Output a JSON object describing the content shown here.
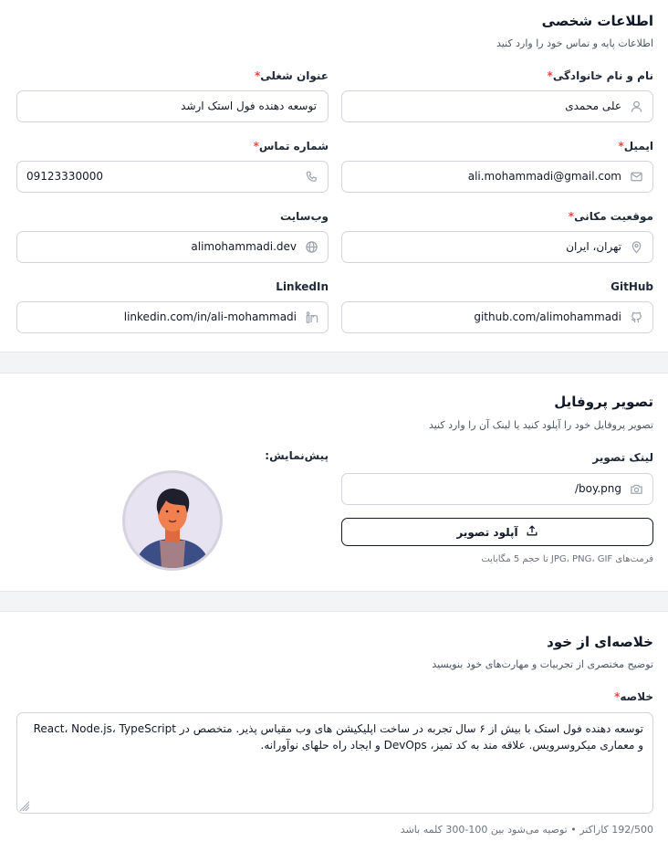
{
  "personal": {
    "title": "اطلاعات شخصی",
    "subtitle": "اطلاعات پایه و تماس خود را وارد کنید",
    "fullname_label": "نام و نام خانوادگی",
    "fullname_value": "علی محمدی",
    "jobtitle_label": "عنوان شغلی",
    "jobtitle_value": "توسعه دهنده فول استک ارشد",
    "email_label": "ایمیل",
    "email_value": "ali.mohammadi@gmail.com",
    "phone_label": "شماره تماس",
    "phone_value": "09123330000",
    "location_label": "موقعیت مکانی",
    "location_value": "تهران، ایران",
    "website_label": "وب‌سایت",
    "website_value": "alimohammadi.dev",
    "github_label": "GitHub",
    "github_value": "github.com/alimohammadi",
    "linkedin_label": "LinkedIn",
    "linkedin_value": "linkedin.com/in/ali-mohammadi",
    "required_mark": "*"
  },
  "profile": {
    "title": "تصویر پروفایل",
    "subtitle": "تصویر پروفایل خود را آپلود کنید یا لینک آن را وارد کنید",
    "image_link_label": "لینک تصویر",
    "image_link_value": "/boy.png",
    "upload_button": "آپلود تصویر",
    "formats_hint": "فرمت‌های JPG، PNG، GIF تا حجم 5 مگابایت",
    "preview_label": "پیش‌نمایش:"
  },
  "summary": {
    "title": "خلاصه‌ای از خود",
    "subtitle": "توضیح مختصری از تجربیات و مهارت‌های خود بنویسید",
    "label": "خلاصه",
    "value": "توسعه دهنده فول استک با بیش از ۶ سال تجربه در ساخت اپلیکیشن های وب مقیاس پذیر. متخصص در React، Node.js، TypeScript و معماری میکروسرویس. علاقه مند به کد تمیز، DevOps و ایجاد راه حلهای نوآورانه.",
    "counter": "192/500 کاراکتر • توصیه می‌شود بین 100-300 کلمه باشد"
  },
  "colors": {
    "required": "#ef4444",
    "border": "#d1d5db",
    "icon": "#9ca3af"
  }
}
